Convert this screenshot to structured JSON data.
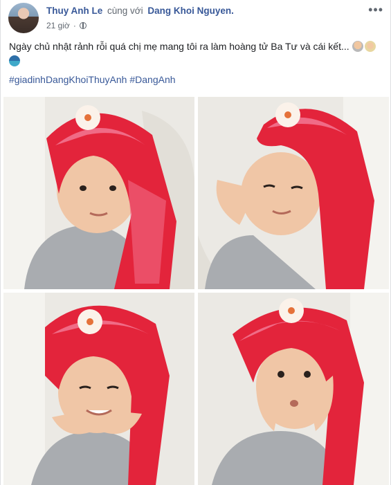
{
  "post": {
    "author": "Thuy Anh Le",
    "with_text": "cùng với",
    "tagged": "Dang Khoi Nguyen.",
    "time": "21 giờ",
    "privacy_icon": "globe-icon",
    "more_icon": "more-dots-icon",
    "more_label": "•••",
    "text": "Ngày chủ nhật rảnh rỗi quá chị mẹ mang tôi ra làm hoàng tử Ba Tư và cái kết...",
    "emoji_icons": [
      "person-emoji-icon",
      "person-emoji-icon",
      "genie-emoji-icon"
    ],
    "hashtags": [
      "#giadinhDangKhoiThuyAnh",
      "#DangAnh"
    ],
    "photos": [
      "boy-scarf-photo",
      "boy-scarf-photo",
      "boy-scarf-photo",
      "boy-scarf-photo"
    ]
  },
  "colors": {
    "link": "#385898",
    "secondary_text": "#606770",
    "scarf_red": "#e3243b",
    "scarf_pink": "#f06b86"
  }
}
